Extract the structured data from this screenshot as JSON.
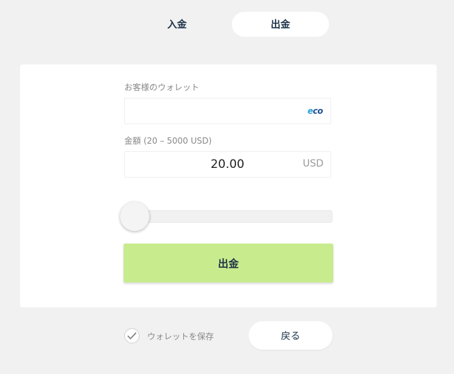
{
  "tabs": {
    "deposit_label": "入金",
    "withdraw_label": "出金",
    "active": "withdraw"
  },
  "form": {
    "wallet_label": "お客様のウォレット",
    "wallet_value": "",
    "wallet_provider_icon": "ecopayz-eco-logo",
    "wallet_logo_text_e": "e",
    "wallet_logo_text_rest": "co",
    "amount_label": "金額 (20 – 5000 USD)",
    "amount_value": "20.00",
    "currency": "USD",
    "slider_fraction": 0.0,
    "submit_label": "出金"
  },
  "footer": {
    "save_wallet_label": "ウォレットを保存",
    "save_wallet_checked": true,
    "back_label": "戻る"
  },
  "colors": {
    "background": "#f1f1f1",
    "card": "#ffffff",
    "submit_button": "#c8eb8e",
    "primary_text": "#1b3147",
    "muted_text": "#888888",
    "eco_blue": "#1d4f91",
    "eco_light_blue": "#2a9fd6"
  }
}
